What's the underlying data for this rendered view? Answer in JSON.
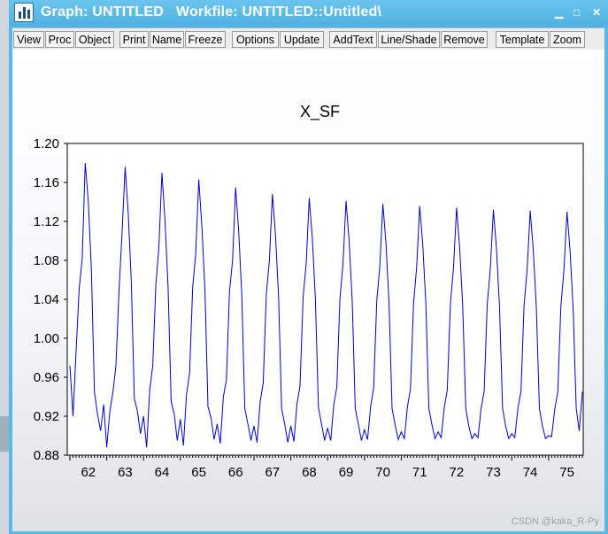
{
  "window": {
    "title": "Graph: UNTITLED   Workfile: UNTITLED::Untitled\\",
    "controls": {
      "minimize": "▁",
      "maximize": "□",
      "close": "✕"
    }
  },
  "toolbar": {
    "buttons": [
      "View",
      "Proc",
      "Object",
      "Print",
      "Name",
      "Freeze",
      "Options",
      "Update",
      "AddText",
      "Line/Shade",
      "Remove",
      "Template",
      "Zoom"
    ]
  },
  "watermark": "CSDN @kaka_R-Py",
  "colors": {
    "title_bar": "#58b8e6",
    "series": "#0000cc"
  },
  "chart_data": {
    "type": "line",
    "title": "X_SF",
    "ylim": [
      0.88,
      1.2
    ],
    "yticks": [
      "1.20",
      "1.16",
      "1.12",
      "1.08",
      "1.04",
      "1.00",
      "0.96",
      "0.92",
      "0.88"
    ],
    "xticks": [
      "62",
      "63",
      "64",
      "65",
      "66",
      "67",
      "68",
      "69",
      "70",
      "71",
      "72",
      "73",
      "74",
      "75"
    ],
    "x_start": "1962M01",
    "frequency": "monthly",
    "grid": false,
    "legend": "none",
    "series": [
      {
        "values": [
          0.972,
          0.92,
          0.985,
          1.05,
          1.082,
          1.18,
          1.14,
          1.07,
          0.945,
          0.922,
          0.905,
          0.932,
          0.888,
          0.925,
          0.944,
          0.972,
          1.049,
          1.108,
          1.176,
          1.128,
          1.06,
          0.938,
          0.925,
          0.902,
          0.92,
          0.888,
          0.946,
          0.972,
          1.055,
          1.093,
          1.17,
          1.12,
          1.053,
          0.935,
          0.922,
          0.895,
          0.917,
          0.89,
          0.942,
          0.964,
          1.052,
          1.086,
          1.163,
          1.115,
          1.049,
          0.93,
          0.918,
          0.896,
          0.912,
          0.892,
          0.94,
          0.957,
          1.048,
          1.08,
          1.155,
          1.11,
          1.045,
          0.928,
          0.912,
          0.895,
          0.91,
          0.893,
          0.935,
          0.954,
          1.045,
          1.08,
          1.148,
          1.106,
          1.042,
          0.928,
          0.912,
          0.893,
          0.91,
          0.894,
          0.933,
          0.951,
          1.042,
          1.077,
          1.144,
          1.103,
          1.04,
          0.929,
          0.912,
          0.895,
          0.908,
          0.895,
          0.932,
          0.95,
          1.04,
          1.077,
          1.141,
          1.1,
          1.038,
          0.928,
          0.912,
          0.895,
          0.906,
          0.896,
          0.93,
          0.949,
          1.038,
          1.074,
          1.138,
          1.098,
          1.036,
          0.928,
          0.911,
          0.896,
          0.904,
          0.897,
          0.93,
          0.948,
          1.036,
          1.073,
          1.136,
          1.096,
          1.035,
          0.928,
          0.911,
          0.897,
          0.904,
          0.898,
          0.929,
          0.947,
          1.035,
          1.072,
          1.134,
          1.094,
          1.034,
          0.928,
          0.91,
          0.897,
          0.902,
          0.898,
          0.928,
          0.946,
          1.034,
          1.071,
          1.132,
          1.093,
          1.033,
          0.928,
          0.91,
          0.897,
          0.902,
          0.898,
          0.928,
          0.946,
          1.033,
          1.07,
          1.131,
          1.092,
          1.032,
          0.928,
          0.91,
          0.897,
          0.9,
          0.899,
          0.927,
          0.945,
          1.032,
          1.07,
          1.13,
          1.09,
          1.031,
          0.928,
          0.905,
          0.945
        ]
      }
    ]
  }
}
